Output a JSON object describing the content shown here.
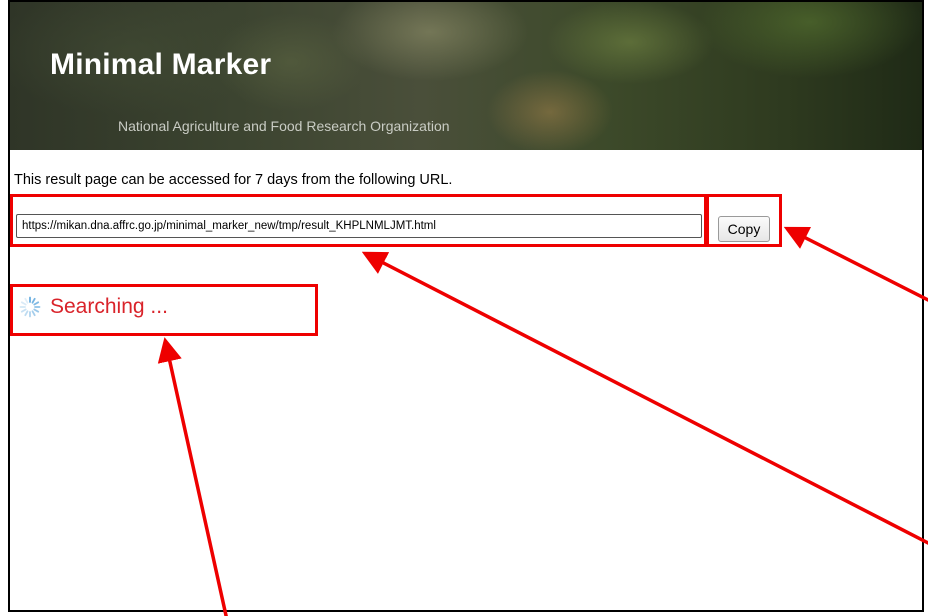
{
  "header": {
    "title": "Minimal Marker",
    "subtitle": "National Agriculture and Food Research Organization"
  },
  "result": {
    "note": "This result page can be accessed for 7 days from the following URL.",
    "url": "https://mikan.dna.affrc.go.jp/minimal_marker_new/tmp/result_KHPLNMLJMT.html",
    "copy_label": "Copy"
  },
  "status": {
    "text": "Searching ...",
    "icon": "spinner-icon"
  },
  "colors": {
    "annotation": "#ee0000",
    "status_text": "#d9232a",
    "spinner": "#6aaee0"
  }
}
